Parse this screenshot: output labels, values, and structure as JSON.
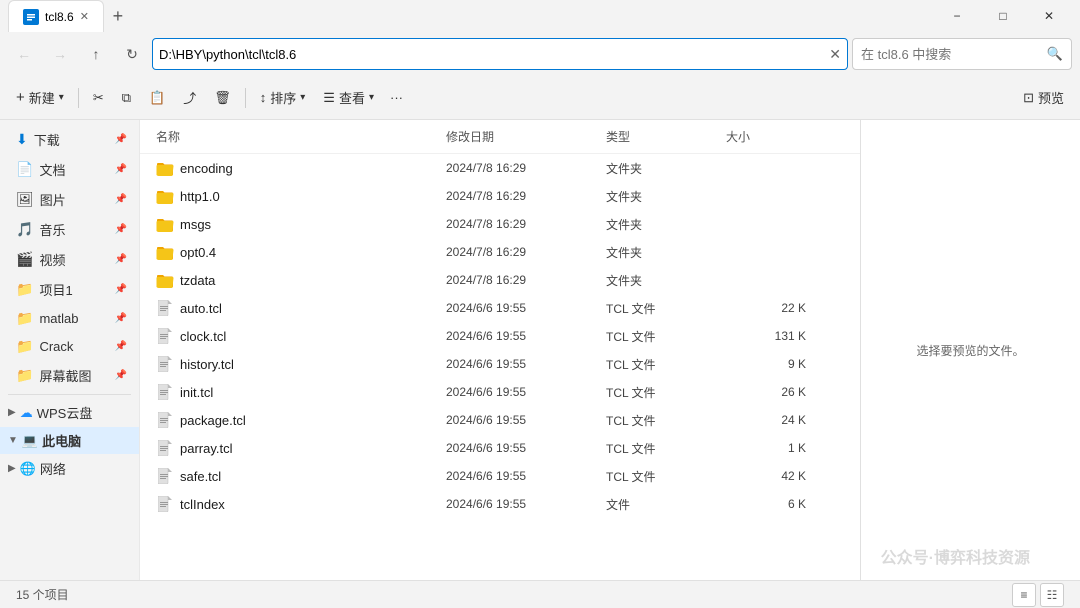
{
  "window": {
    "title": "tcl8.6",
    "tab_label": "tcl8.6",
    "new_tab_icon": "+",
    "min_icon": "−",
    "max_icon": "□",
    "close_icon": "✕"
  },
  "address_bar": {
    "path": "D:\\HBY\\python\\tcl\\tcl8.6",
    "clear_icon": "✕",
    "search_placeholder": "在 tcl8.6 中搜索"
  },
  "toolbar": {
    "new_label": "新建",
    "cut_icon": "✂",
    "copy_icon": "⧉",
    "paste_icon": "⬒",
    "share_icon": "⤴",
    "delete_icon": "🗑",
    "sort_label": "排序",
    "view_label": "查看",
    "more_icon": "···",
    "preview_label": "预览"
  },
  "sidebar": {
    "items": [
      {
        "id": "download",
        "label": "下载",
        "icon": "⬇",
        "color_class": "si-color-dl",
        "pinned": true
      },
      {
        "id": "document",
        "label": "文档",
        "icon": "📄",
        "color_class": "si-color-doc",
        "pinned": true
      },
      {
        "id": "image",
        "label": "图片",
        "icon": "🖼",
        "color_class": "si-color-img",
        "pinned": true
      },
      {
        "id": "music",
        "label": "音乐",
        "icon": "🎵",
        "color_class": "si-color-music",
        "pinned": true
      },
      {
        "id": "video",
        "label": "视频",
        "icon": "🎬",
        "color_class": "si-color-video",
        "pinned": true
      },
      {
        "id": "project",
        "label": "项目1",
        "icon": "📁",
        "color_class": "si-color-proj",
        "pinned": true
      },
      {
        "id": "matlab",
        "label": "matlab",
        "icon": "📁",
        "color_class": "si-color-matlab",
        "pinned": true
      },
      {
        "id": "crack",
        "label": "Crack",
        "icon": "📁",
        "color_class": "si-color-crack",
        "pinned": true
      },
      {
        "id": "screenshot",
        "label": "屏幕截图",
        "icon": "📁",
        "color_class": "si-color-screen",
        "pinned": true
      }
    ],
    "sections": [
      {
        "id": "wps",
        "label": "WPS云盘",
        "icon": "☁",
        "color_class": "si-color-wps",
        "expanded": false
      },
      {
        "id": "thispc",
        "label": "此电脑",
        "icon": "💻",
        "color_class": "si-color-pc",
        "expanded": true,
        "active": true
      },
      {
        "id": "network",
        "label": "网络",
        "icon": "🌐",
        "color_class": "si-color-net",
        "expanded": false
      }
    ]
  },
  "file_list": {
    "columns": [
      "名称",
      "修改日期",
      "类型",
      "大小"
    ],
    "items": [
      {
        "name": "encoding",
        "date": "2024/7/8 16:29",
        "type": "文件夹",
        "size": "",
        "is_folder": true
      },
      {
        "name": "http1.0",
        "date": "2024/7/8 16:29",
        "type": "文件夹",
        "size": "",
        "is_folder": true
      },
      {
        "name": "msgs",
        "date": "2024/7/8 16:29",
        "type": "文件夹",
        "size": "",
        "is_folder": true
      },
      {
        "name": "opt0.4",
        "date": "2024/7/8 16:29",
        "type": "文件夹",
        "size": "",
        "is_folder": true
      },
      {
        "name": "tzdata",
        "date": "2024/7/8 16:29",
        "type": "文件夹",
        "size": "",
        "is_folder": true
      },
      {
        "name": "auto.tcl",
        "date": "2024/6/6 19:55",
        "type": "TCL 文件",
        "size": "22 K",
        "is_folder": false
      },
      {
        "name": "clock.tcl",
        "date": "2024/6/6 19:55",
        "type": "TCL 文件",
        "size": "131 K",
        "is_folder": false
      },
      {
        "name": "history.tcl",
        "date": "2024/6/6 19:55",
        "type": "TCL 文件",
        "size": "9 K",
        "is_folder": false
      },
      {
        "name": "init.tcl",
        "date": "2024/6/6 19:55",
        "type": "TCL 文件",
        "size": "26 K",
        "is_folder": false
      },
      {
        "name": "package.tcl",
        "date": "2024/6/6 19:55",
        "type": "TCL 文件",
        "size": "24 K",
        "is_folder": false
      },
      {
        "name": "parray.tcl",
        "date": "2024/6/6 19:55",
        "type": "TCL 文件",
        "size": "1 K",
        "is_folder": false
      },
      {
        "name": "safe.tcl",
        "date": "2024/6/6 19:55",
        "type": "TCL 文件",
        "size": "42 K",
        "is_folder": false
      },
      {
        "name": "tclIndex",
        "date": "2024/6/6 19:55",
        "type": "文件",
        "size": "6 K",
        "is_folder": false
      }
    ]
  },
  "preview": {
    "text": "选择要预览的文件。"
  },
  "status_bar": {
    "item_count": "15 个项目"
  },
  "watermark": {
    "text": "公众号·博弈科技资源"
  }
}
